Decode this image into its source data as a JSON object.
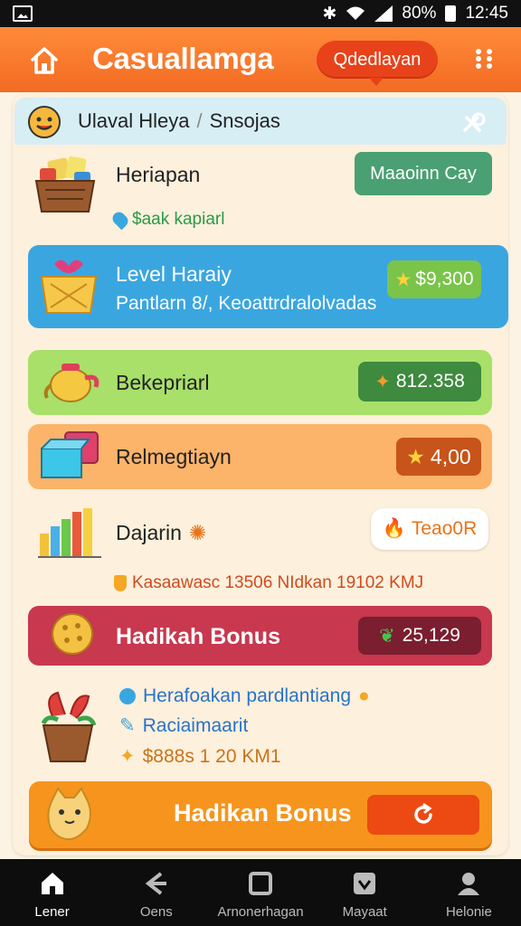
{
  "status_bar": {
    "battery": "80%",
    "time": "12:45"
  },
  "header": {
    "title": "Casuallamga",
    "pill_label": "Qdedlayan"
  },
  "breadcrumb": {
    "first": "Ulaval Hleya",
    "separator": "/",
    "second": "Snsojas"
  },
  "rows": [
    {
      "title": "Heriapan",
      "button": "Maaoinn Cay",
      "sub": "$aak kapiarl"
    },
    {
      "title": "Level Haraiy",
      "sub": "Pantlarn 8/, Keoattrdralolvadas",
      "value": "$9,300"
    },
    {
      "title": "Bekepriarl",
      "value": "812.358"
    },
    {
      "title": "Relmegtiayn",
      "value": "4,00"
    },
    {
      "title": "Dajarin",
      "button": "Teao0R",
      "sub": "Kasaawasc 13506 NIdkan 19102 KMJ"
    },
    {
      "title": "Hadikah Bonus",
      "value": "25,129"
    }
  ],
  "list": [
    {
      "text": "Herafoakan pardlantiang"
    },
    {
      "text": "Raciaimaarit"
    },
    {
      "text": "$888s 1 20 KM1"
    }
  ],
  "bonus_button": {
    "label": "Hadikan Bonus"
  },
  "nav": [
    {
      "label": "Lener"
    },
    {
      "label": "Oens"
    },
    {
      "label": "Arnonerhagan"
    },
    {
      "label": "Mayaat"
    },
    {
      "label": "Helonie"
    }
  ],
  "colors": {
    "header": "#f26b22",
    "blue_card": "#3aa6e0",
    "green_card": "#a8e06a",
    "orange_card": "#fbb46a",
    "red_card": "#c8384e",
    "accent_orange": "#f7941d"
  },
  "icons": {
    "header_left": "home-icon",
    "header_right": "grid-icon",
    "breadcrumb_close": "close-icon"
  }
}
